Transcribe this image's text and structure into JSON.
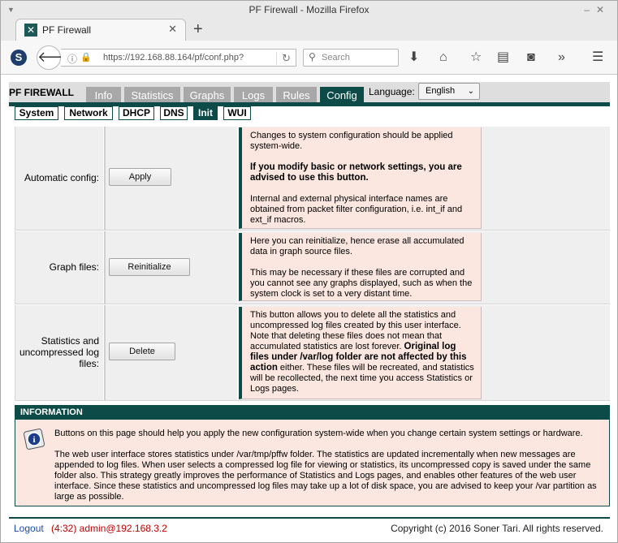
{
  "window": {
    "title": "PF Firewall - Mozilla Firefox",
    "tab_title": "PF Firewall",
    "url": "https://192.168.88.164/pf/conf.php?",
    "search_placeholder": "Search"
  },
  "header": {
    "brand": "PF FIREWALL",
    "menu": [
      "Info",
      "Statistics",
      "Graphs",
      "Logs",
      "Rules",
      "Config"
    ],
    "active_menu": "Config",
    "language_label": "Language:",
    "language_value": "English"
  },
  "subtabs": [
    "System",
    "Network",
    "DHCP",
    "DNS",
    "Init",
    "WUI"
  ],
  "active_subtab": "Init",
  "rows": [
    {
      "label": "Automatic config:",
      "button": "Apply",
      "help": [
        "Changes to system configuration should be applied system-wide.",
        "If you modify basic or network settings, you are advised to use this button.",
        "Internal and external physical interface names are obtained from packet filter configuration, i.e. int_if and ext_if macros."
      ]
    },
    {
      "label": "Graph files:",
      "button": "Reinitialize",
      "help": [
        "Here you can reinitialize, hence erase all accumulated data in graph source files.",
        "This may be necessary if these files are corrupted and you cannot see any graphs displayed, such as when the system clock is set to a very distant time."
      ]
    },
    {
      "label_lines": [
        "Statistics and",
        "uncompressed log",
        "files:"
      ],
      "button": "Delete",
      "help_parts": {
        "a": "This button allows you to delete all the statistics and uncompressed log files created by this user interface. Note that deleting these files does not mean that accumulated statistics are lost forever. ",
        "b": "Original log files under /var/log folder are not affected by this action",
        "c": " either. These files will be recreated, and statistics will be recollected, the next time you access Statistics or Logs pages."
      }
    }
  ],
  "information": {
    "title": "INFORMATION",
    "p1": "Buttons on this page should help you apply the new configuration system-wide when you change certain system settings or hardware.",
    "p2": "The web user interface stores statistics under /var/tmp/pffw folder. The statistics are updated incrementally when new messages are appended to log files. When user selects a compressed log file for viewing or statistics, its uncompressed copy is saved under the same folder also. This strategy greatly improves the performance of Statistics and Logs pages, and enables other features of the web user interface. Since these statistics and uncompressed log files may take up a lot of disk space, you are advised to keep your /var partition as large as possible."
  },
  "footer": {
    "logout": "Logout",
    "session": "(4:32) admin@192.168.3.2",
    "copyright": "Copyright (c) 2016 Soner Tari. All rights reserved."
  },
  "colors": {
    "accent": "#0d4b49",
    "help_bg": "#fbe7df",
    "tab_gray": "#a8a8a8"
  }
}
